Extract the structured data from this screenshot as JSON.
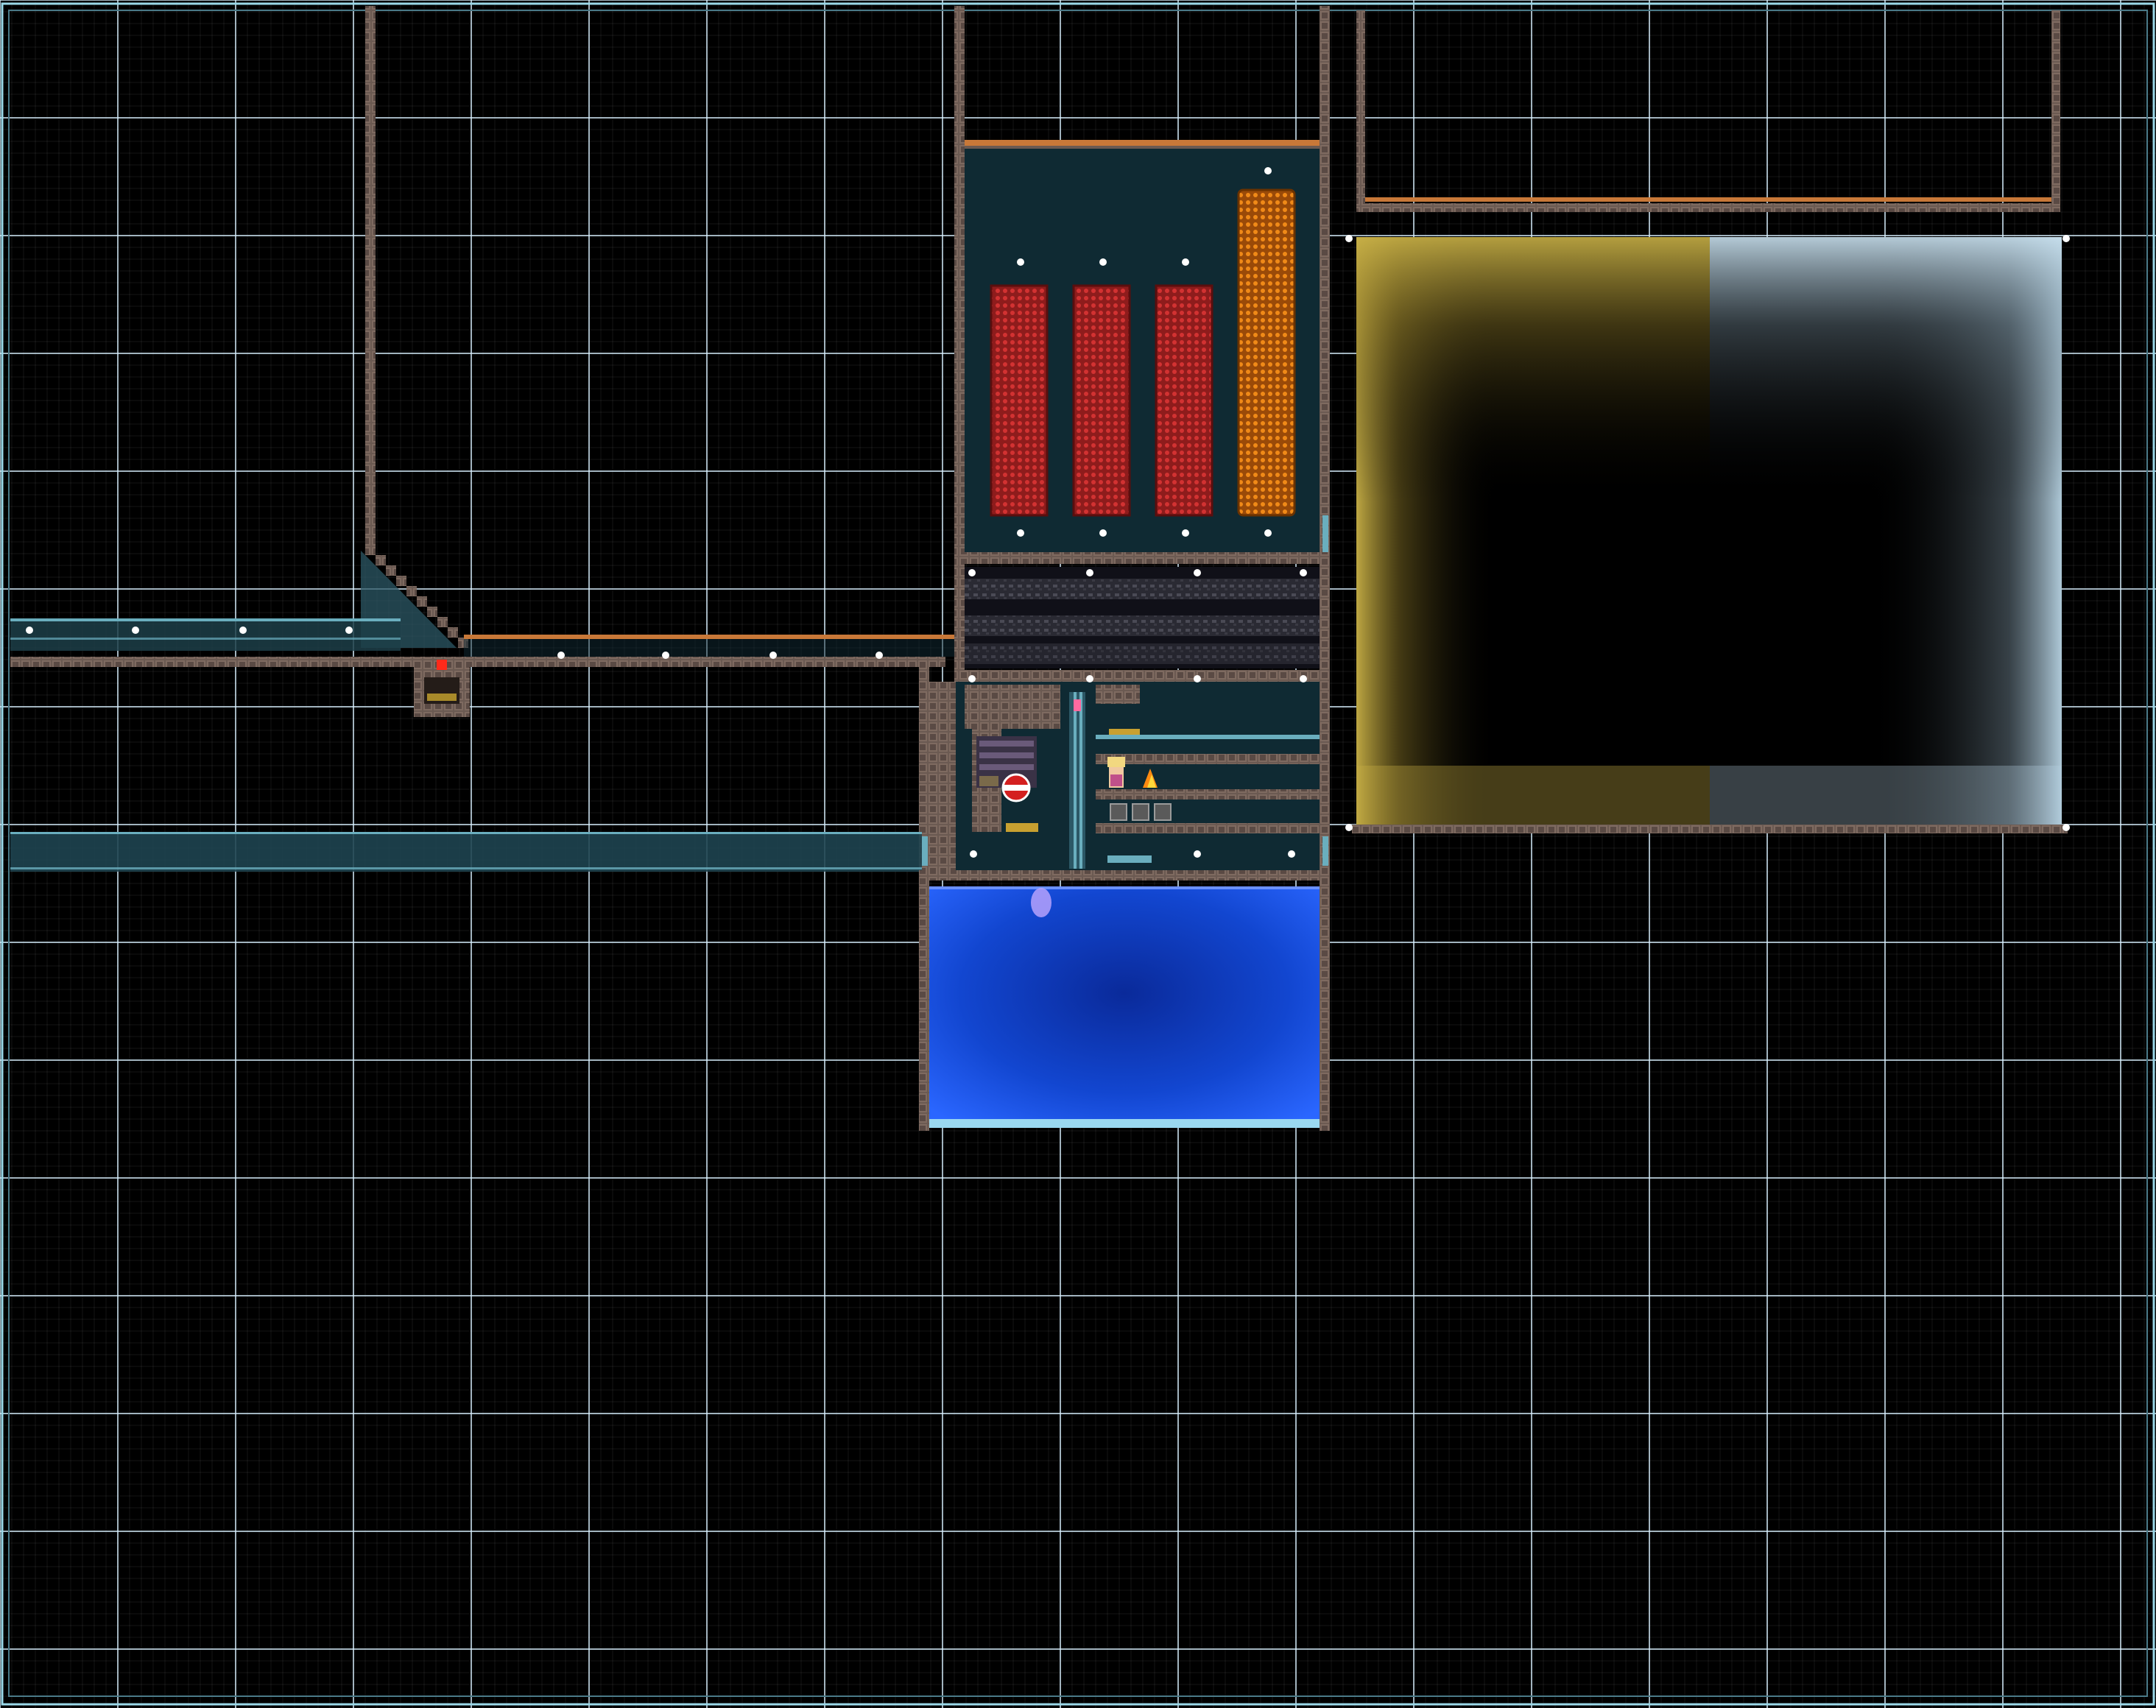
{
  "view": {
    "background": "#000000",
    "grid_color": "#ffffff",
    "grid_major_color": "#d8f0ff",
    "frame_color": "#9ad8e8"
  },
  "palette": {
    "wall": "#6b5a52",
    "wall_dark": "#3d3430",
    "copper_trim": "#c87838",
    "glass": "#2c5866",
    "room_bg": "#0f2a33",
    "red_tank": "#c42a2a",
    "orange_tank": "#e07a10",
    "gold_block": "#c8b046",
    "silver_block": "#b8d4e4",
    "water": "#1448d8",
    "water_top": "#6a90ff",
    "light_bulb": "#ffffff",
    "switch_red": "#ff2a1a"
  },
  "scene": {
    "tanks": [
      "red",
      "red",
      "red",
      "orange"
    ],
    "storage_blocks": [
      "gold",
      "silver"
    ],
    "pool": "water",
    "icons": [
      "light-icon",
      "switch-icon",
      "crafting-station-icon",
      "bed-icon",
      "character-sprite-icon",
      "campfire-icon",
      "chest-icon",
      "spawn-point-icon"
    ]
  }
}
